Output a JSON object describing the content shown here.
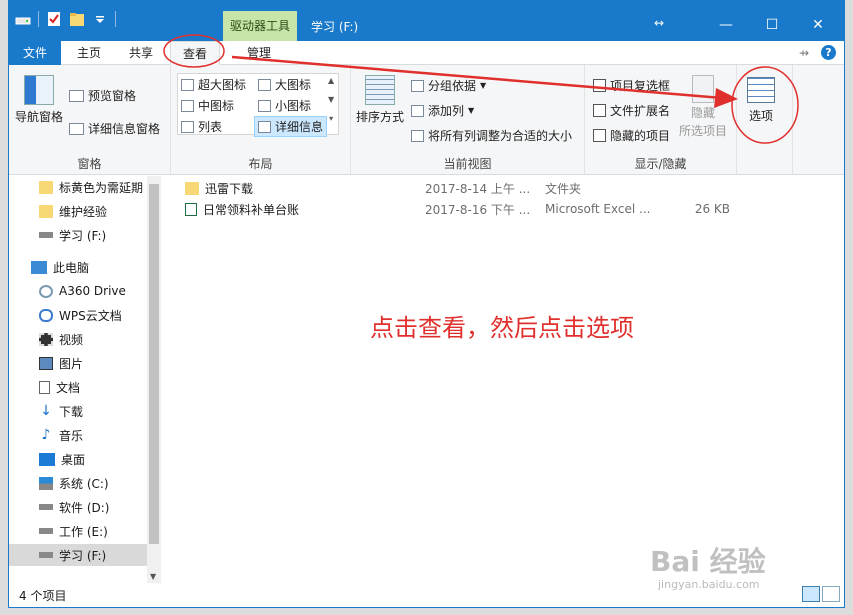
{
  "titlebar": {
    "drive_tools": "驱动器工具",
    "title": "学习 (F:)",
    "minimize": "—",
    "maximize": "☐",
    "close": "✕",
    "resize_glyph": "↔"
  },
  "tabs": [
    {
      "label": "文件"
    },
    {
      "label": "主页"
    },
    {
      "label": "共享"
    },
    {
      "label": "查看"
    },
    {
      "label": "管理"
    }
  ],
  "ribbon": {
    "pane_group": {
      "label": "窗格",
      "nav_pane": "导航窗格",
      "preview_pane": "预览窗格",
      "details_pane": "详细信息窗格"
    },
    "layout_group": {
      "label": "布局",
      "extra_large_icons": "超大图标",
      "large_icons": "大图标",
      "medium_icons": "中图标",
      "small_icons": "小图标",
      "list": "列表",
      "details": "详细信息"
    },
    "current_view_group": {
      "label": "当前视图",
      "sort_by": "排序方式",
      "group_by": "分组依据",
      "add_columns": "添加列",
      "size_all_columns": "将所有列调整为合适的大小"
    },
    "show_hide_group": {
      "label": "显示/隐藏",
      "item_checkboxes": "项目复选框",
      "file_extensions": "文件扩展名",
      "hidden_items": "隐藏的项目",
      "hide_selected": "隐藏",
      "hide_selected_sub": "所选项目"
    },
    "options": "选项"
  },
  "nav": {
    "items": [
      {
        "label": "标黄色为需延期"
      },
      {
        "label": "维护经验"
      },
      {
        "label": "学习 (F:)"
      },
      {
        "label": "此电脑"
      },
      {
        "label": "A360 Drive"
      },
      {
        "label": "WPS云文档"
      },
      {
        "label": "视频"
      },
      {
        "label": "图片"
      },
      {
        "label": "文档"
      },
      {
        "label": "下载"
      },
      {
        "label": "音乐"
      },
      {
        "label": "桌面"
      },
      {
        "label": "系统 (C:)"
      },
      {
        "label": "软件 (D:)"
      },
      {
        "label": "工作 (E:)"
      },
      {
        "label": "学习 (F:)"
      }
    ]
  },
  "files": [
    {
      "name": "迅雷下载",
      "date": "2017-8-14 上午 ...",
      "type": "文件夹",
      "size": ""
    },
    {
      "name": "日常领料补单台账",
      "date": "2017-8-16 下午 ...",
      "type": "Microsoft Excel ...",
      "size": "26 KB"
    }
  ],
  "annotation": "点击查看，然后点击选项",
  "status": {
    "count": "4 个项目"
  },
  "watermark": {
    "main": "Bai 经验",
    "sub": "jingyan.baidu.com"
  },
  "colors": {
    "titlebar": "#1979ca",
    "annotation": "#e0302e",
    "drive_tools": "#c7e5a9"
  }
}
